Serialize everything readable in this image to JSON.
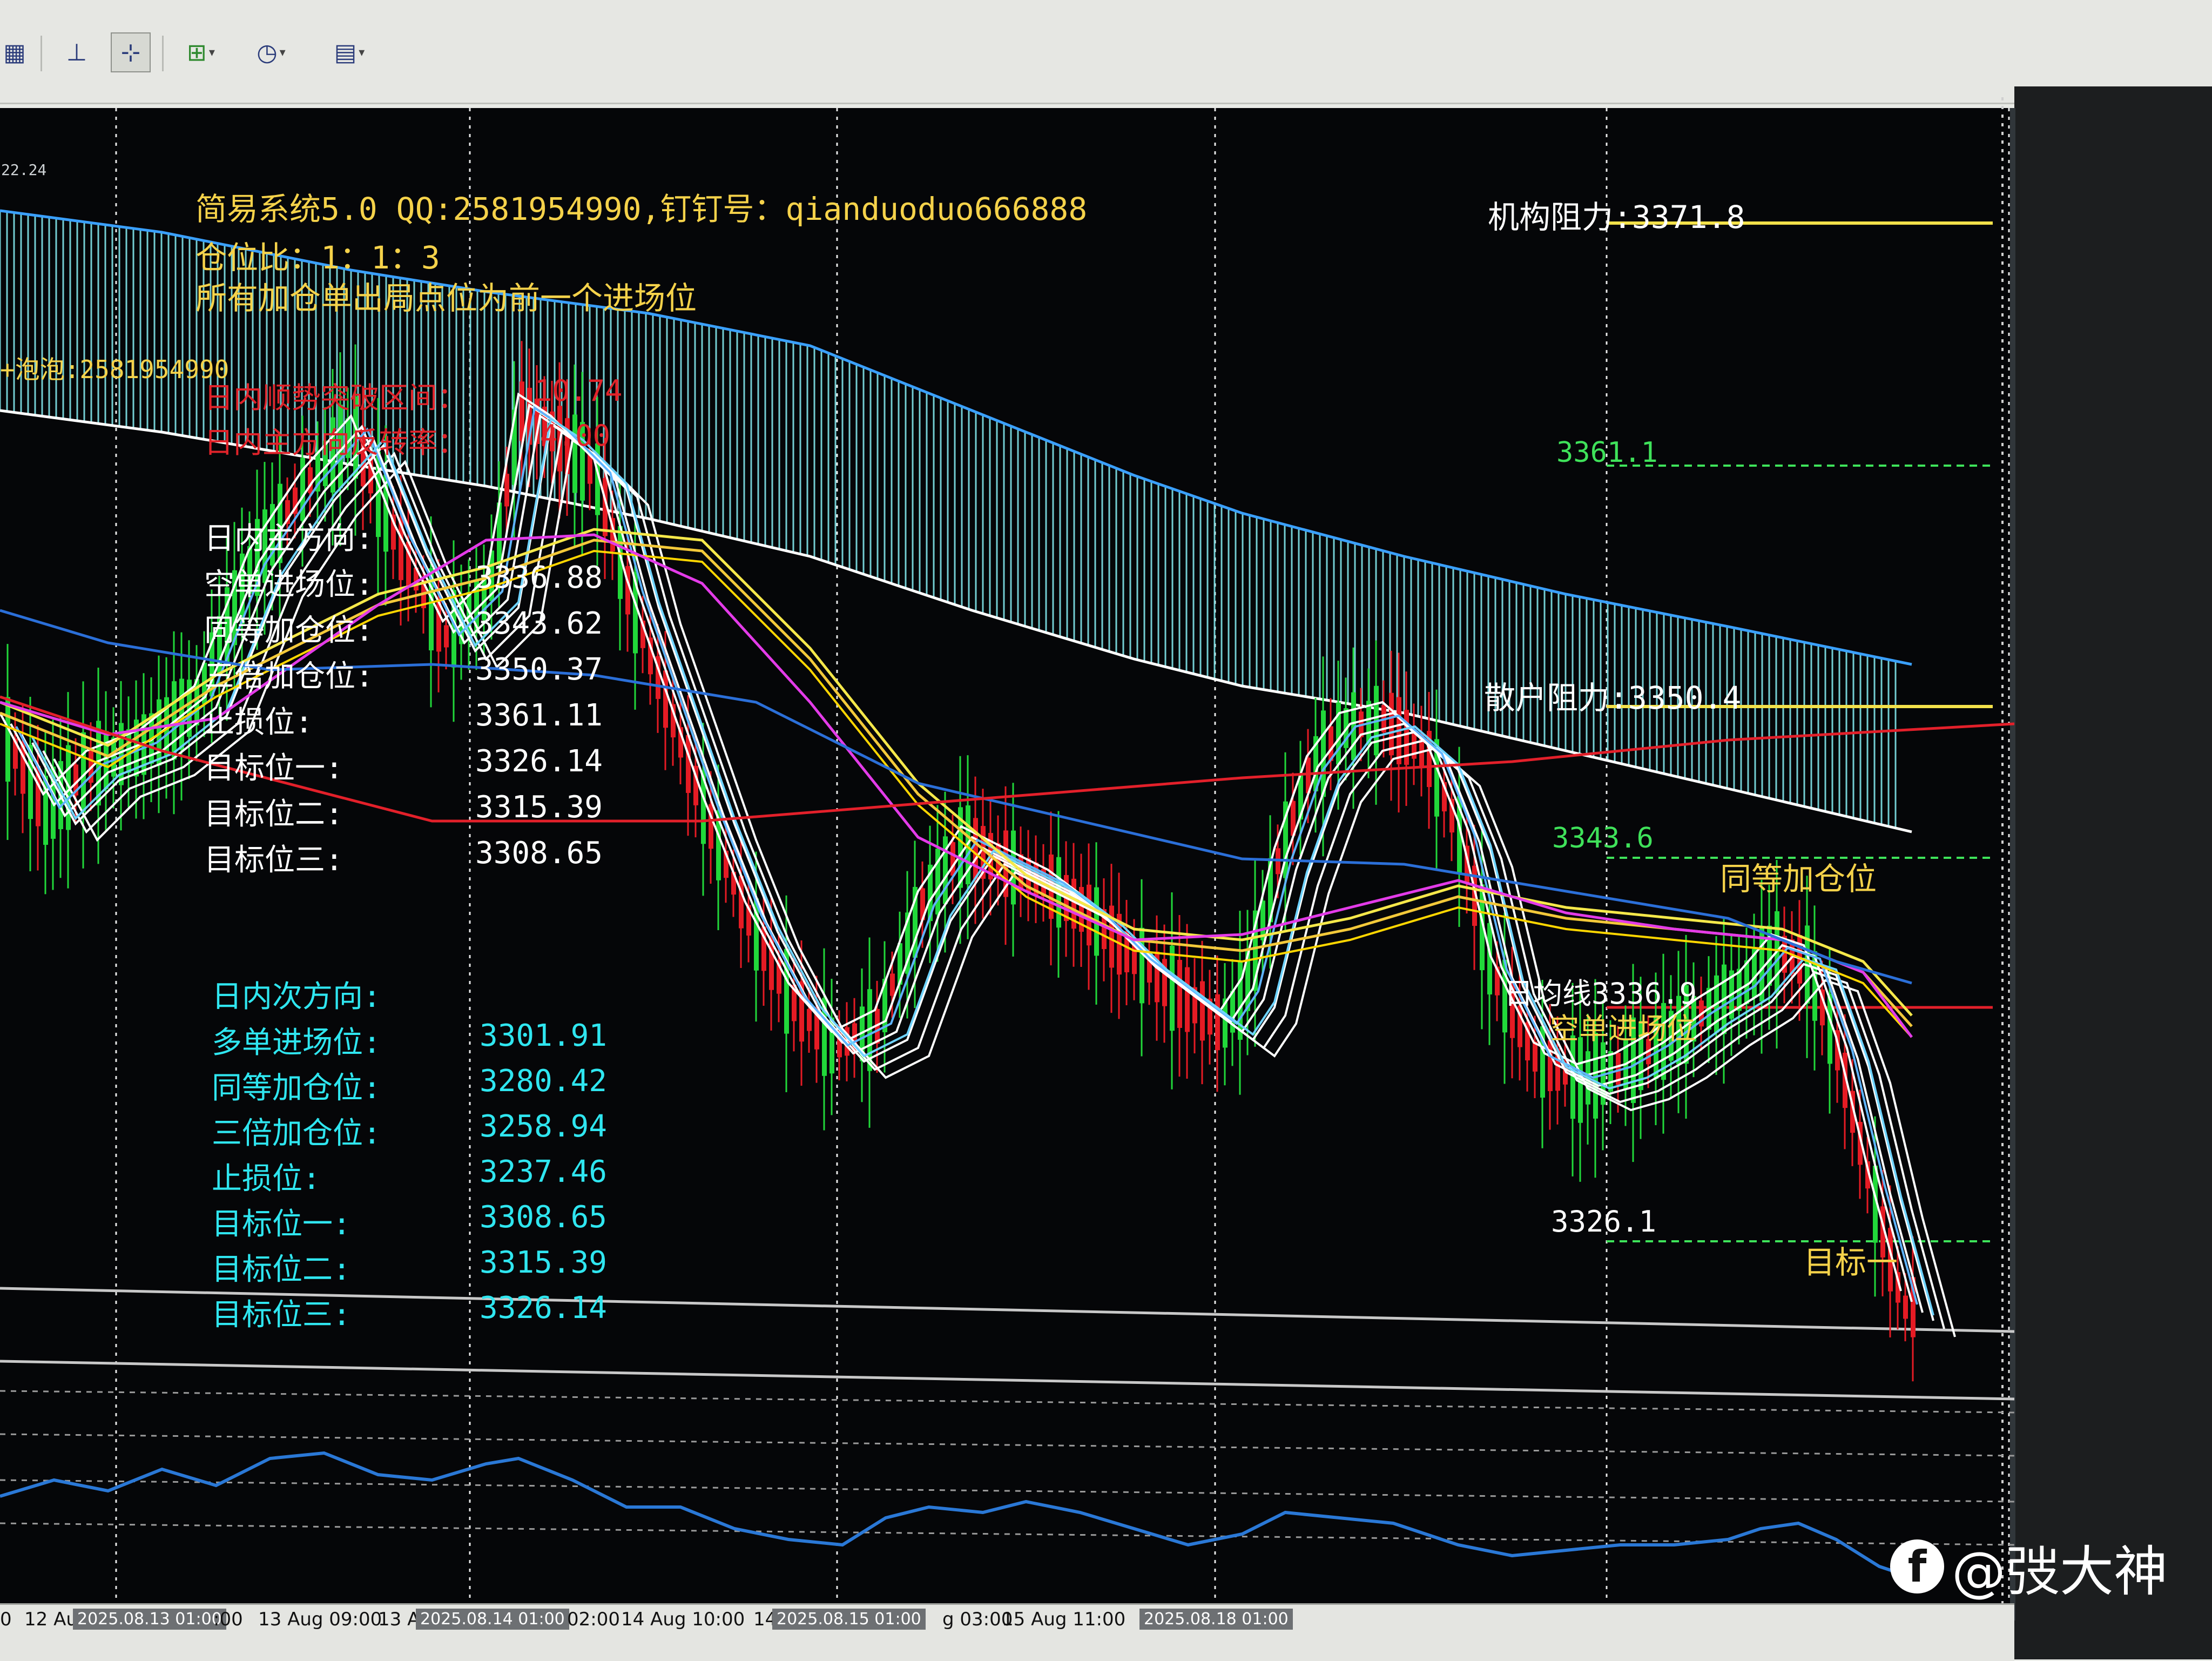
{
  "toolbar": {
    "icons": [
      "grid-icon",
      "period-axis-icon",
      "crosshair-icon",
      "add-indicator-icon",
      "clock-icon",
      "template-icon"
    ]
  },
  "corner_time": "22.24",
  "header": {
    "system": "简易系统5.0 QQ:2581954990,钉钉号：qianduoduo666888",
    "ratio": "仓位比：1：1：3",
    "rule": "所有加仓单出局点位为前一个进场位",
    "contact": "+泡泡:2581954990"
  },
  "stats": {
    "range_label": "日内顺势突破区间：",
    "range_value": "10.74",
    "rate_label": "日内主方向反转率：",
    "rate_value": "4.00"
  },
  "main_direction": {
    "title": "日内主方向:",
    "rows": [
      {
        "label": "空单进场位:",
        "value": "3336.88"
      },
      {
        "label": "同等加仓位:",
        "value": "3343.62"
      },
      {
        "label": "三倍加仓位:",
        "value": "3350.37"
      },
      {
        "label": "止损位:",
        "value": "3361.11"
      },
      {
        "label": "目标位一:",
        "value": "3326.14"
      },
      {
        "label": "目标位二:",
        "value": "3315.39"
      },
      {
        "label": "目标位三:",
        "value": "3308.65"
      }
    ]
  },
  "secondary_direction": {
    "title": "日内次方向:",
    "rows": [
      {
        "label": "多单进场位:",
        "value": "3301.91"
      },
      {
        "label": "同等加仓位:",
        "value": "3280.42"
      },
      {
        "label": "三倍加仓位:",
        "value": "3258.94"
      },
      {
        "label": "止损位:",
        "value": "3237.46"
      },
      {
        "label": "目标位一:",
        "value": "3308.65"
      },
      {
        "label": "目标位二:",
        "value": "3315.39"
      },
      {
        "label": "目标位三:",
        "value": "3326.14"
      }
    ]
  },
  "levels": {
    "inst_resist": "机构阻力:3371.8",
    "l3361": "3361.1",
    "retail_resist": "散户阻力:3350.4",
    "l3343": "3343.6",
    "add_pos": "同等加仓位",
    "daily_ma": "日均线3336.9",
    "short_entry": "空单进场位",
    "l3326": "3326.1",
    "target1": "目标一"
  },
  "time_axis": {
    "labels": [
      "0",
      "12 Au",
      "2025.08.13 01:00",
      ":00",
      "13 Aug 09:00",
      "13 A",
      "2025.08.14 01:00",
      "02:00",
      "14 Aug 10:00",
      "14",
      "2025.08.15 01:00",
      "g 03:00",
      "15 Aug 11:00",
      "2025.08.18 01:00"
    ]
  },
  "watermark": "@弢大神",
  "colors": {
    "bull": "#21d83a",
    "bear": "#e51b24",
    "band": "#7fe3e8",
    "level_yellow": "#f3e14a",
    "level_green": "#3ee35a",
    "red_ma": "#e3202a",
    "blue_ma": "#2b6fd8",
    "magenta_ma": "#e33be8",
    "indicator": "#2a78d6"
  }
}
